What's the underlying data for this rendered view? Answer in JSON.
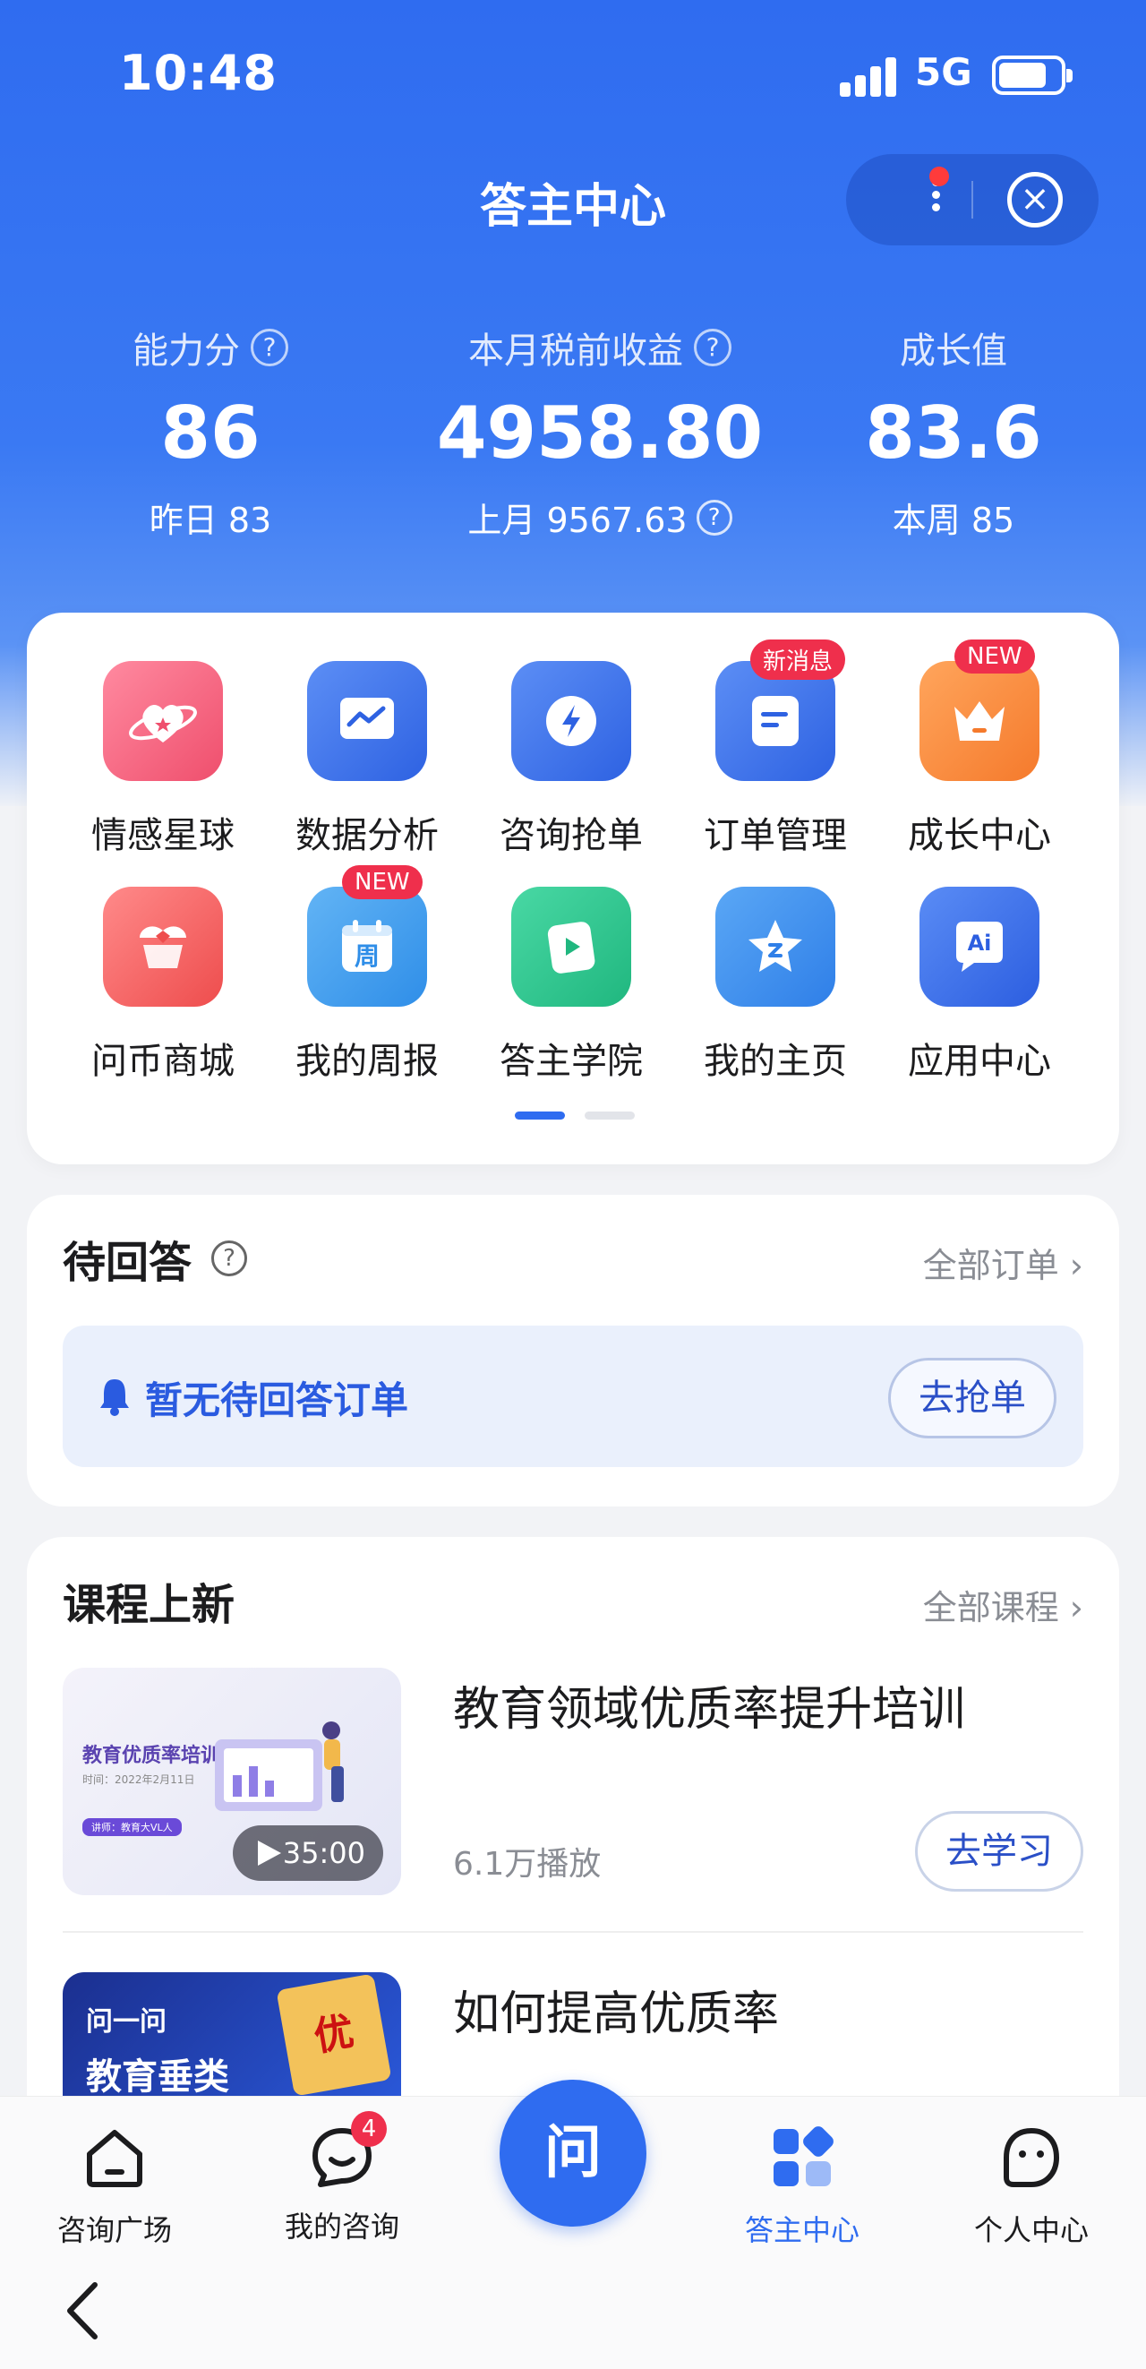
{
  "status": {
    "time": "10:48",
    "network": "5G"
  },
  "header": {
    "title": "答主中心"
  },
  "stats": [
    {
      "label": "能力分",
      "value": "86",
      "sub": "昨日 83"
    },
    {
      "label": "本月税前收益",
      "value": "4958.80",
      "sub": "上月 9567.63"
    },
    {
      "label": "成长值",
      "value": "83.6",
      "sub": "本周 85"
    }
  ],
  "grid": {
    "items": [
      {
        "label": "情感星球",
        "icon": "heart-planet-icon"
      },
      {
        "label": "数据分析",
        "icon": "chart-icon"
      },
      {
        "label": "咨询抢单",
        "icon": "lightning-icon"
      },
      {
        "label": "订单管理",
        "icon": "document-icon",
        "badge": "新消息"
      },
      {
        "label": "成长中心",
        "icon": "crown-icon",
        "badge": "NEW"
      },
      {
        "label": "问币商城",
        "icon": "shop-icon"
      },
      {
        "label": "我的周报",
        "icon": "calendar-icon",
        "badge": "NEW",
        "glyph": "周"
      },
      {
        "label": "答主学院",
        "icon": "play-book-icon"
      },
      {
        "label": "我的主页",
        "icon": "star-home-icon"
      },
      {
        "label": "应用中心",
        "icon": "ai-chat-icon",
        "glyph": "Ai"
      }
    ],
    "page_index": 1,
    "page_count": 2
  },
  "pending": {
    "title": "待回答",
    "more": "全部订单",
    "notice": "暂无待回答订单",
    "button": "去抢单"
  },
  "courses": {
    "title": "课程上新",
    "more": "全部课程",
    "items": [
      {
        "title": "教育领域优质率提升培训",
        "plays": "6.1万播放",
        "button": "去学习",
        "duration": "35:00",
        "thumb_title": "教育优质率培训",
        "thumb_sub": "时间：2022年2月11日",
        "thumb_tag": "讲师：教育大VL人"
      },
      {
        "title": "如何提高优质率",
        "thumb_brand": "问一问",
        "thumb_title": "教育垂类",
        "thumb_scroll": "优"
      }
    ]
  },
  "tabbar": {
    "items": [
      {
        "label": "咨询广场",
        "icon": "house-icon"
      },
      {
        "label": "我的咨询",
        "icon": "chat-bubble-icon",
        "badge": "4"
      },
      {
        "label": "答主中心",
        "icon": "app-grid-icon",
        "active": true
      },
      {
        "label": "个人中心",
        "icon": "smile-face-icon"
      }
    ],
    "center": "问"
  }
}
